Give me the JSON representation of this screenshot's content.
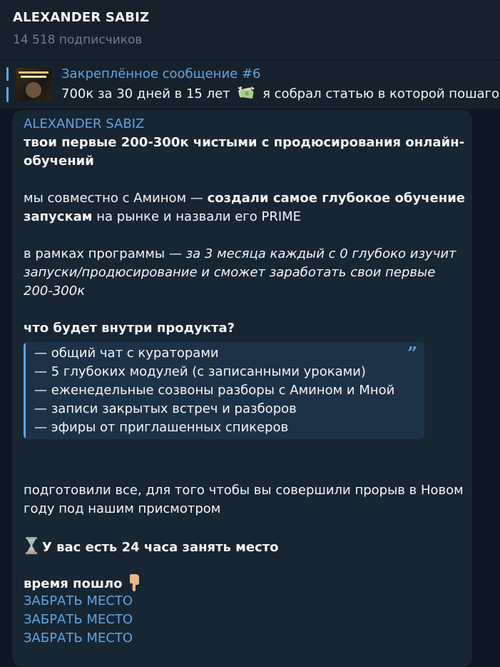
{
  "header": {
    "channel_name": "ALEXANDER SABIZ",
    "subscribers": "14 518 подписчиков"
  },
  "pinned": {
    "title": "Закреплённое сообщение #6",
    "text_before": "700к за 30 дней в 15 лет",
    "text_after": "я собрал статью в которой пошагово"
  },
  "message": {
    "author": "ALEXANDER SABIZ",
    "headline_1": "твои первые 200-300к чистыми с продюсирования онлайн-",
    "headline_2": "обучений",
    "p1_a": "мы совместно с Амином — ",
    "p1_b": "создали самое глубокое обучение",
    "p1_c": "запускам",
    "p1_d": " на рынке и назвали его PRIME",
    "p2_a": "в рамках программы — ",
    "p2_b": "за 3 месяца каждый с 0 глубоко изучит",
    "p2_c": "запуски/продюсирование и сможет заработать свои первые",
    "p2_d": "200-300к",
    "section_title": "что будет внутри продукта?",
    "quote_items": [
      "— общий чат с кураторами",
      "— 5 глубоких модулей (с записанными уроками)",
      "— еженедельные созвоны разборы с Амином и Мной",
      "— записи закрытых встреч и разборов",
      "— эфиры от приглашенных спикеров"
    ],
    "p3_a": "подготовили все, для того чтобы вы совершили прорыв в Новом",
    "p3_b": "году под нашим присмотром",
    "deadline": "У вас есть 24 часа занять место",
    "time_text": "время пошло",
    "links": [
      "ЗАБРАТЬ МЕСТО",
      "ЗАБРАТЬ МЕСТО",
      "ЗАБРАТЬ МЕСТО"
    ]
  },
  "colors": {
    "background": "#0e1621",
    "panel": "#17212b",
    "bubble": "#182533",
    "accent": "#5fa5e2"
  },
  "icons": {
    "pinned_thumbnail": "pinned-post-thumbnail",
    "money": "money-with-wings-icon",
    "quote": "quote-icon",
    "hourglass": "hourglass-icon",
    "pointing": "pointing-down-icon"
  }
}
